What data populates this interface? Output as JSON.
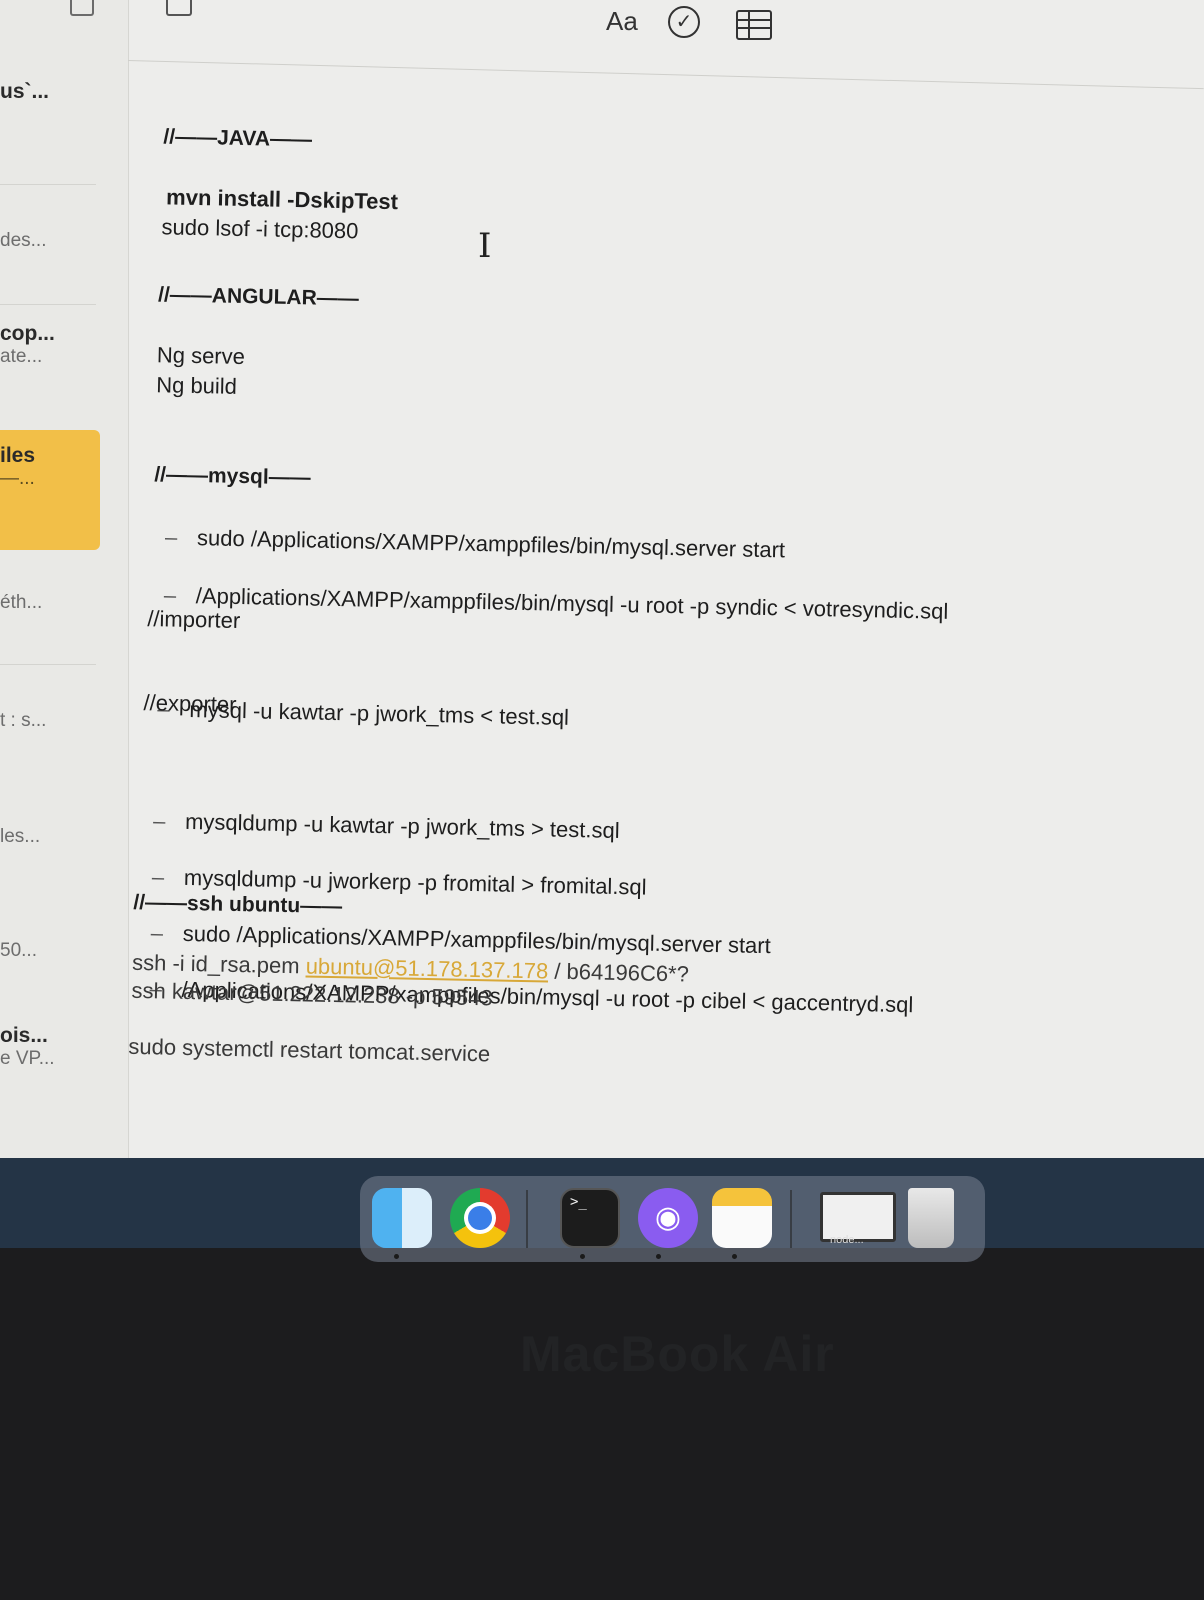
{
  "toolbar": {
    "font_label": "Aa",
    "checklist_icon": "checklist-icon",
    "table_icon": "table-icon"
  },
  "sidebar": {
    "items": [
      {
        "title": "us`...",
        "sub": ""
      },
      {
        "title": "",
        "sub": "des..."
      },
      {
        "title": "cop...",
        "sub": "ate..."
      },
      {
        "title": "iles",
        "sub": "—..."
      },
      {
        "title": "",
        "sub": "éth..."
      },
      {
        "title": "",
        "sub": "t : s..."
      },
      {
        "title": "",
        "sub": "les..."
      },
      {
        "title": "",
        "sub": "50..."
      },
      {
        "title": "ois...",
        "sub": "e VP..."
      }
    ]
  },
  "note": {
    "java_head": "//——JAVA——",
    "java_cmd1": "mvn install -DskipTest",
    "java_cmd2": "sudo lsof -i tcp:8080",
    "angular_head": "//——ANGULAR——",
    "angular_cmd1": "Ng serve",
    "angular_cmd2": "Ng build",
    "mysql_head": "//——mysql——",
    "mysql_cmd1": "sudo /Applications/XAMPP/xamppfiles/bin/mysql.server start",
    "mysql_cmd2": "/Applications/XAMPP/xamppfiles/bin/mysql -u root -p syndic < votresyndic.sql",
    "importer_label": "//importer",
    "importer_cmd1": "mysql -u kawtar -p jwork_tms < test.sql",
    "exporter_label": "//exporter",
    "exporter_cmd1": "mysqldump -u kawtar -p jwork_tms > test.sql",
    "exporter_cmd2": "mysqldump -u jworkerp -p fromital > fromital.sql",
    "exporter_cmd3": "sudo /Applications/XAMPP/xamppfiles/bin/mysql.server start",
    "exporter_cmd4": "/Applications/XAMPP/xamppfiles/bin/mysql -u root -p cibel < gaccentryd.sql",
    "ssh_head": "//——ssh ubuntu——",
    "ssh_cmd1_prefix": "ssh -i id_rsa.pem ",
    "ssh_cmd1_link": "ubuntu@51.178.137.178",
    "ssh_cmd1_suffix": " / b64196C6*?",
    "ssh_cmd2": "ssh kawtar@51.222.12.238 -p 59543",
    "tomcat_cmd": "sudo systemctl restart tomcat.service"
  },
  "dock": {
    "apps": [
      "finder-icon",
      "chrome-icon",
      "terminal-icon",
      "github-desktop-icon",
      "notes-icon",
      "window-thumbnail",
      "trash-icon"
    ],
    "terminal_glyph": ">_",
    "github_glyph": "◉",
    "thumb_label": "node..."
  },
  "bezel": {
    "label": "MacBook Air"
  }
}
